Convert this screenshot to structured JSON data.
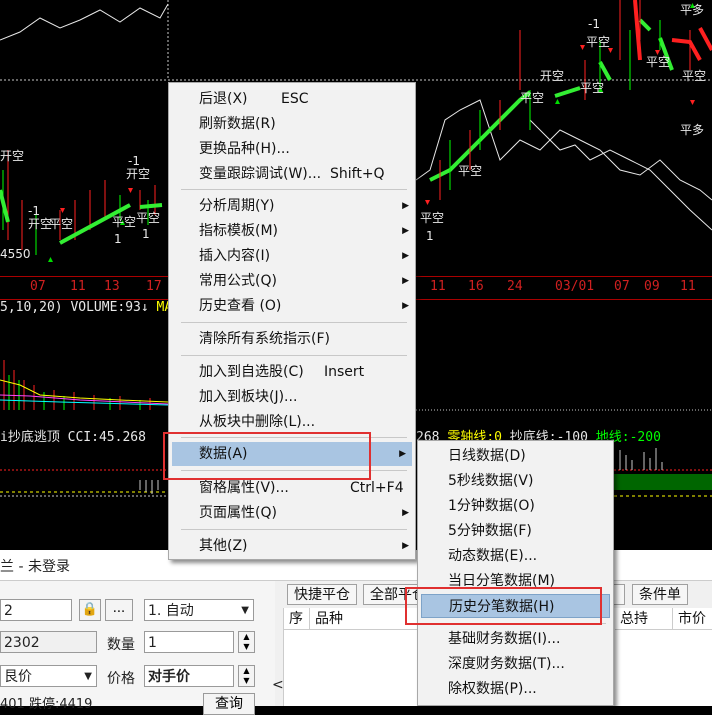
{
  "chart": {
    "dates": [
      "07",
      "11",
      "13",
      "17",
      "11",
      "16",
      "24",
      "03/01",
      "07",
      "09",
      "11"
    ],
    "volume_prefix": "5,10,20) VOLUME:93",
    "volume_arrow": "↓",
    "volume_ma": "MA",
    "cci_left": "i抄底逃顶 CCI:45.268",
    "cci_value": "268",
    "cci_zero": "零轴线:0",
    "cci_bottom": "抄底线:-100",
    "cci_ground": "地线:-200",
    "price_label": "4550",
    "signals": {
      "open_short": "开空",
      "close_long": "平多",
      "close_short": "平空",
      "minus_one": "-1",
      "one": "1"
    },
    "colors": {
      "up": "#ff2020",
      "down": "#00ff00",
      "price_line": "#e8e8e8",
      "signal_dn": "#ff2020",
      "signal_up": "#00dd00"
    }
  },
  "panel": {
    "title": "兰 - 未登录",
    "account_value": "2",
    "lock_icon": "lock-icon",
    "ellipsis": "...",
    "mode_value": "1. 自动",
    "contract_value": "2302",
    "qty_label": "数量",
    "qty_value": "1",
    "price_type": "艮价",
    "price_label": "价格",
    "price_value": "对手价",
    "limit_text": "401 跌停:4419",
    "query_button": "查询",
    "tabs": [
      "快捷平仓",
      "全部平仓",
      "",
      "条件单"
    ],
    "headers": [
      "序",
      "品种",
      "总持",
      "市价"
    ],
    "collapse_icon": "<"
  },
  "menu": {
    "items": [
      {
        "label": "后退(X)",
        "shortcut": "ESC"
      },
      {
        "label": "刷新数据(R)",
        "shortcut": ""
      },
      {
        "label": "更换品种(H)...",
        "shortcut": ""
      },
      {
        "label": "变量跟踪调试(W)...",
        "shortcut": "Shift+Q"
      },
      {
        "label": "分析周期(Y)",
        "shortcut": ""
      },
      {
        "label": "指标模板(M)",
        "shortcut": ""
      },
      {
        "label": "插入内容(I)",
        "shortcut": ""
      },
      {
        "label": "常用公式(Q)",
        "shortcut": ""
      },
      {
        "label": "历史查看 (O)",
        "shortcut": ""
      },
      {
        "label": "清除所有系统指示(F)",
        "shortcut": ""
      },
      {
        "label": "加入到自选股(C)",
        "shortcut": "Insert"
      },
      {
        "label": "加入到板块(J)...",
        "shortcut": ""
      },
      {
        "label": "从板块中删除(L)...",
        "shortcut": ""
      },
      {
        "label": "数据(A)",
        "shortcut": ""
      },
      {
        "label": "窗格属性(V)...",
        "shortcut": "Ctrl+F4"
      },
      {
        "label": "页面属性(Q)",
        "shortcut": ""
      },
      {
        "label": "其他(Z)",
        "shortcut": ""
      }
    ]
  },
  "submenu": {
    "items": [
      "日线数据(D)",
      "5秒线数据(V)",
      "1分钟数据(O)",
      "5分钟数据(F)",
      "动态数据(E)...",
      "当日分笔数据(M)",
      "历史分笔数据(H)",
      "基础财务数据(I)...",
      "深度财务数据(T)...",
      "除权数据(P)..."
    ]
  }
}
